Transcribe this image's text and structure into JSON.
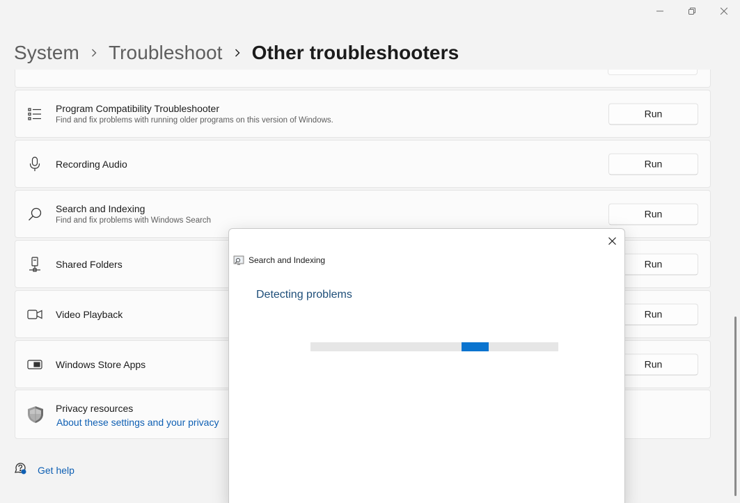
{
  "window": {
    "controls": [
      "minimize-icon",
      "restore-icon",
      "close-icon"
    ]
  },
  "breadcrumb": {
    "items": [
      "System",
      "Troubleshoot",
      "Other troubleshooters"
    ]
  },
  "troubleshooters": [
    {
      "title": "Program Compatibility Troubleshooter",
      "description": "Find and fix problems with running older programs on this version of Windows.",
      "icon": "list-icon",
      "button": "Run"
    },
    {
      "title": "Recording Audio",
      "description": "",
      "icon": "microphone-icon",
      "button": "Run"
    },
    {
      "title": "Search and Indexing",
      "description": "Find and fix problems with Windows Search",
      "icon": "search-icon",
      "button": "Run"
    },
    {
      "title": "Shared Folders",
      "description": "",
      "icon": "network-drive-icon",
      "button": "Run"
    },
    {
      "title": "Video Playback",
      "description": "",
      "icon": "video-camera-icon",
      "button": "Run"
    },
    {
      "title": "Windows Store Apps",
      "description": "",
      "icon": "store-apps-icon",
      "button": "Run"
    }
  ],
  "privacy": {
    "title": "Privacy resources",
    "link": "About these settings and your privacy",
    "icon": "shield-icon"
  },
  "help": {
    "label": "Get help",
    "icon": "help-chat-icon"
  },
  "dialog": {
    "app_title": "Search and Indexing",
    "status": "Detecting problems",
    "progress": {
      "style": "indeterminate",
      "chunk_position_fraction": 0.61
    },
    "accent_color": "#0a74cf"
  },
  "colors": {
    "link": "#0e5fb3",
    "status_text": "#1e4e79",
    "background": "#f3f3f3"
  }
}
